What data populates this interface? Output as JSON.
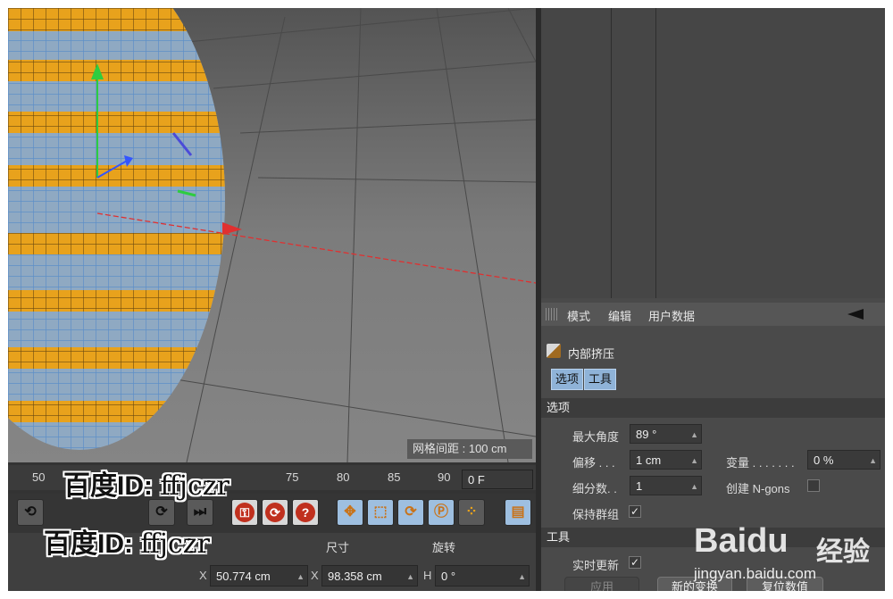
{
  "viewport": {
    "grid_spacing": "网格间距 : 100 cm"
  },
  "attributes": {
    "menu": [
      "模式",
      "编辑",
      "用户数据"
    ],
    "object_name": "内部挤压",
    "tabs": [
      "选项",
      "工具"
    ],
    "options_section": "选项",
    "max_angle_label": "最大角度",
    "max_angle_value": "89 °",
    "offset_label": "偏移 . . .",
    "offset_value": "1 cm",
    "variance_label": "变量 . . . . . . .",
    "variance_value": "0 %",
    "subdivision_label": "细分数. .",
    "subdivision_value": "1",
    "create_ngons_label": "创建 N-gons",
    "preserve_groups_label": "保持群组",
    "preserve_groups_check": "✓",
    "tool_section": "工具",
    "realtime_label": "实时更新",
    "realtime_check": "✓",
    "buttons": [
      "应用",
      "新的变换",
      "复位数值"
    ]
  },
  "timeline": {
    "ticks": [
      "50",
      "75",
      "80",
      "85",
      "90"
    ],
    "frame": "0 F"
  },
  "coordinates": {
    "size_header": "尺寸",
    "rotation_header": "旋转",
    "x_label": "X",
    "x_value": "50.774 cm",
    "size_x_label": "X",
    "size_x_value": "98.358 cm",
    "h_label": "H",
    "h_value": "0 °"
  },
  "watermarks": {
    "prefix": "百度ID:",
    "user": "ffjczr"
  },
  "baidu": {
    "logo": "Baidu",
    "cn": "经验",
    "url": "jingyan.baidu.com"
  },
  "colors": {
    "accent_tab": "#8fb3d8",
    "selection": "#e8a21c",
    "wire": "#6fa8dc"
  }
}
